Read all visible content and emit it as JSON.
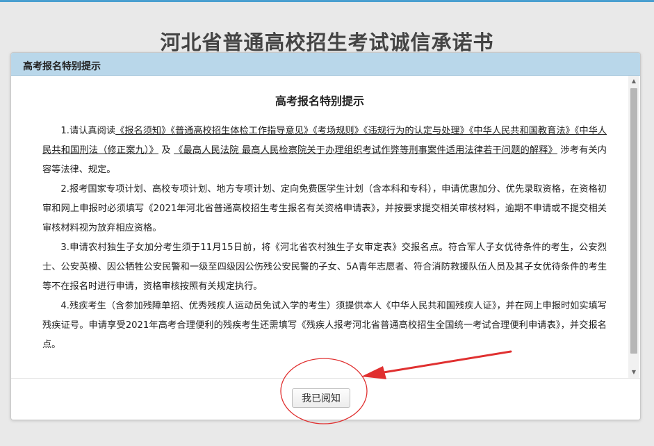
{
  "page": {
    "heading": "河北省普通高校招生考试诚信承诺书"
  },
  "dialog": {
    "header_title": "高考报名特别提示",
    "content_title": "高考报名特别提示",
    "paragraphs": [
      {
        "parts": [
          {
            "text": "1.请认真阅读",
            "u": false
          },
          {
            "text": "《报名须知》《普通高校招生体检工作指导意见》《考场规则》《违规行为的认定与处理》《中华人民共和国教育法》《中华人民共和国刑法（修正案九）》",
            "u": true
          },
          {
            "text": " 及 ",
            "u": false
          },
          {
            "text": "《最高人民法院 最高人民检察院关于办理组织考试作弊等刑事案件适用法律若干问题的解释》",
            "u": true
          },
          {
            "text": " 涉考有关内容等法律、规定。",
            "u": false
          }
        ]
      },
      {
        "parts": [
          {
            "text": "2.报考国家专项计划、高校专项计划、地方专项计划、定向免费医学生计划（含本科和专科），申请优惠加分、优先录取资格，在资格初审和网上申报时必须填写《2021年河北省普通高校招生考生报名有关资格申请表》，并按要求提交相关审核材料，逾期不申请或不提交相关审核材料视为放弃相应资格。",
            "u": false
          }
        ]
      },
      {
        "parts": [
          {
            "text": "3.申请农村独生子女加分考生须于11月15日前，将《河北省农村独生子女审定表》交报名点。符合军人子女优待条件的考生，公安烈士、公安英模、因公牺牲公安民警和一级至四级因公伤残公安民警的子女、5A青年志愿者、符合消防救援队伍人员及其子女优待条件的考生等不在报名时进行申请，资格审核按照有关规定执行。",
            "u": false
          }
        ]
      },
      {
        "parts": [
          {
            "text": "4.残疾考生（含参加残障单招、优秀残疾人运动员免试入学的考生）须提供本人《中华人民共和国残疾人证》，并在网上申报时如实填写残疾证号。申请享受2021年高考合理便利的残疾考生还需填写《残疾人报考河北省普通高校招生全国统一考试合理便利申请表》，并交报名点。",
            "u": false
          }
        ]
      }
    ],
    "ack_button_label": "我已阅知"
  },
  "scrollbar": {
    "up_arrow_icon": "triangle-up",
    "down_arrow_icon": "triangle-down"
  },
  "annotation": {
    "color": "#e03030"
  }
}
